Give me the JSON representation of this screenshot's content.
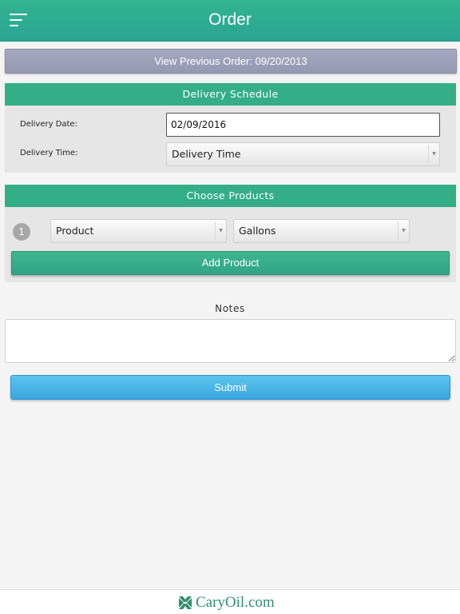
{
  "header": {
    "title": "Order",
    "menu_icon": "hamburger-menu-icon"
  },
  "previous_order": {
    "label": "View Previous Order: 09/20/2013"
  },
  "delivery": {
    "heading": "Delivery Schedule",
    "date_label": "Delivery Date:",
    "date_value": "02/09/2016",
    "time_label": "Delivery Time:",
    "time_value": "Delivery Time"
  },
  "products": {
    "heading": "Choose Products",
    "rows": [
      {
        "number": "1",
        "product_value": "Product",
        "gallons_value": "Gallons"
      }
    ],
    "add_label": "Add Product"
  },
  "notes": {
    "label": "Notes",
    "value": ""
  },
  "submit": {
    "label": "Submit"
  },
  "footer": {
    "brand": "CaryOil.com",
    "logo_icon": "caryoil-logo-icon"
  },
  "colors": {
    "header_green": "#32b48e",
    "panel_head_green": "#34ae87",
    "prev_order_gray": "#9ea1b9",
    "submit_blue": "#4bb6e7",
    "brand_green": "#2e8f6c"
  }
}
